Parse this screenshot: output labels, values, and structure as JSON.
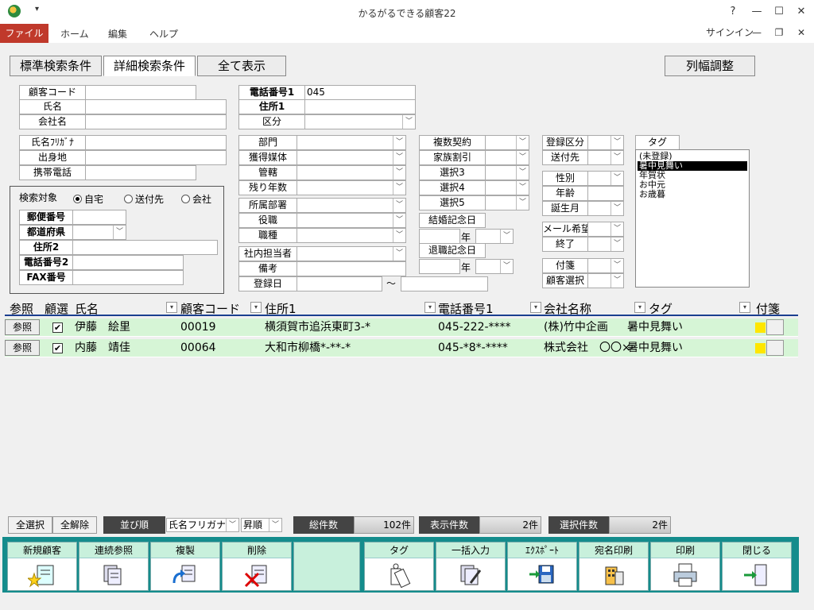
{
  "window": {
    "title": "かるがるできる顧客22",
    "help": "?",
    "minimize": "—",
    "maximize": "☐",
    "close": "✕"
  },
  "qat": "▾",
  "menu": {
    "file": "ファイル",
    "home": "ホーム",
    "edit": "編集",
    "help": "ヘルプ",
    "signin": "サインイン"
  },
  "tabs": {
    "basic": "標準検索条件",
    "detail": "詳細検索条件",
    "all": "全て表示",
    "colwidth": "列幅調整"
  },
  "form": {
    "customer_code": "顧客コード",
    "name": "氏名",
    "company": "会社名",
    "name_kana": "氏名ﾌﾘｶﾞﾅ",
    "birthplace": "出身地",
    "mobile": "携帯電話",
    "search_target": "検索対象",
    "radio_home": "自宅",
    "radio_dest": "送付先",
    "radio_company": "会社",
    "zip": "郵便番号",
    "pref": "都道府県",
    "addr2": "住所2",
    "tel2": "電話番号2",
    "fax": "FAX番号",
    "tel1": "電話番号1",
    "tel1_value": "045",
    "addr1": "住所1",
    "category": "区分",
    "dept": "部門",
    "media": "獲得媒体",
    "jurisdiction": "管轄",
    "years_left": "残り年数",
    "affil": "所属部署",
    "position": "役職",
    "job": "職種",
    "staff": "社内担当者",
    "note": "備考",
    "reg_date": "登録日",
    "tilde": "～",
    "multi_contract": "複数契約",
    "family_disc": "家族割引",
    "sel3": "選択3",
    "sel4": "選択4",
    "sel5": "選択5",
    "wedding": "結婚記念日",
    "retire": "退職記念日",
    "year": "年",
    "reg_cat": "登録区分",
    "send_to": "送付先",
    "gender": "性別",
    "age": "年齢",
    "birth_month": "誕生月",
    "mail_wish": "メール希望",
    "end": "終了",
    "tag_note": "付箋",
    "cust_select": "顧客選択",
    "tag": "タグ"
  },
  "tags": [
    "(未登録)",
    "暑中見舞い",
    "年賀状",
    "お中元",
    "お歳暮"
  ],
  "grid": {
    "headers": [
      "参照",
      "顧選",
      "氏名",
      "顧客コード",
      "住所1",
      "電話番号1",
      "会社名称",
      "タグ",
      "付箋"
    ],
    "rows": [
      {
        "ref": "参照",
        "check": "✔",
        "name": "伊藤　絵里",
        "code": "00019",
        "addr": "横須賀市追浜東町3-*",
        "tel": "045-222-****",
        "company": "(株)竹中企画",
        "tag": "暑中見舞い"
      },
      {
        "ref": "参照",
        "check": "✔",
        "name": "内藤　靖佳",
        "code": "00064",
        "addr": "大和市柳橋*-**-*",
        "tel": "045-*8*-****",
        "company": "株式会社　〇〇×",
        "tag": "暑中見舞い"
      }
    ]
  },
  "bottom": {
    "select_all": "全選択",
    "deselect_all": "全解除",
    "sort": "並び順",
    "sort_key": "氏名フリガナ",
    "sort_dir": "昇順",
    "total_label": "総件数",
    "total_value": "102件",
    "shown_label": "表示件数",
    "shown_value": "2件",
    "selected_label": "選択件数",
    "selected_value": "2件"
  },
  "actions": [
    "新規顧客",
    "連続参照",
    "複製",
    "削除",
    "タグ",
    "一括入力",
    "ｴｸｽﾎﾟｰﾄ",
    "宛名印刷",
    "印刷",
    "閉じる"
  ]
}
